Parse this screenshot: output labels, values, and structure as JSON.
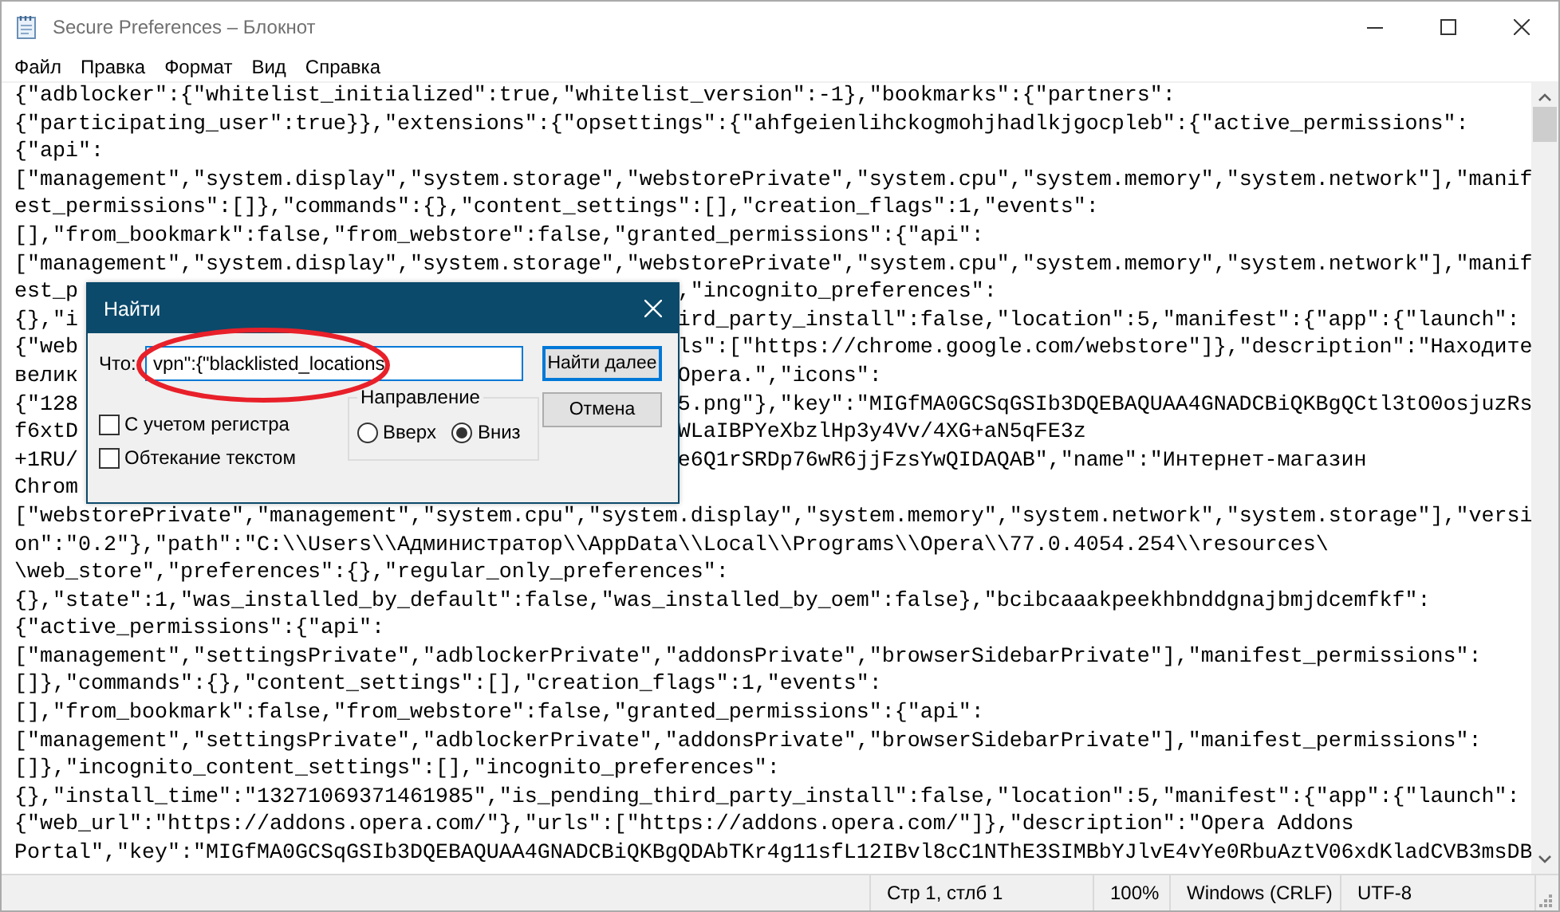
{
  "window": {
    "title": "Secure Preferences – Блокнот"
  },
  "menu": [
    "Файл",
    "Правка",
    "Формат",
    "Вид",
    "Справка"
  ],
  "editor": {
    "lines": [
      {
        "text": "{\"adblocker\":{\"whitelist_initialized\":true,\"whitelist_version\":-1},\"bookmarks\":{\"partners\":"
      },
      {
        "text": "{\"participating_user\":true}},\"extensions\":{\"opsettings\":{\"ahfgeienlihckogmohjhadlkjgocpleb\":{\"active_permissions\":"
      },
      {
        "text": "{\"api\":"
      },
      {
        "text": "[\"management\",\"system.display\",\"system.storage\",\"webstorePrivate\",\"system.cpu\",\"system.memory\",\"system.network\"],\"manif"
      },
      {
        "text": "est_permissions\":[]},\"commands\":{},\"content_settings\":[],\"creation_flags\":1,\"events\":"
      },
      {
        "text": "[],\"from_bookmark\":false,\"from_webstore\":false,\"granted_permissions\":{\"api\":"
      },
      {
        "text": "[\"management\",\"system.display\",\"system.storage\",\"webstorePrivate\",\"system.cpu\",\"system.memory\",\"system.network\"],\"manif"
      },
      {
        "left": "est_p",
        "right": ",\"incognito_preferences\":"
      },
      {
        "left": "{},\"i",
        "right": "ird_party_install\":false,\"location\":5,\"manifest\":{\"app\":{\"launch\":"
      },
      {
        "left": "{\"web",
        "right": "ls\":[\"https://chrome.google.com/webstore\"]},\"description\":\"Находите"
      },
      {
        "left": "велик",
        "right": "Opera.\",\"icons\":"
      },
      {
        "left": "{\"128",
        "right": "5.png\"},\"key\":\"MIGfMA0GCSqGSIb3DQEBAQUAA4GNADCBiQKBgQCtl3tO0osjuzRs"
      },
      {
        "left": "f6xtD",
        "right": "WLaIBPYeXbzlHp3y4Vv/4XG+aN5qFE3z"
      },
      {
        "left": "+1RU/",
        "right": "e6Q1rSRDp76wR6jjFzsYwQIDAQAB\",\"name\":\"Интернет-магазин"
      },
      {
        "left": "Chrom"
      },
      {
        "text": "[\"webstorePrivate\",\"management\",\"system.cpu\",\"system.display\",\"system.memory\",\"system.network\",\"system.storage\"],\"versi"
      },
      {
        "text": "on\":\"0.2\"},\"path\":\"C:\\\\Users\\\\Администратор\\\\AppData\\\\Local\\\\Programs\\\\Opera\\\\77.0.4054.254\\\\resources\\"
      },
      {
        "text": "\\web_store\",\"preferences\":{},\"regular_only_preferences\":"
      },
      {
        "text": "{},\"state\":1,\"was_installed_by_default\":false,\"was_installed_by_oem\":false},\"bcibcaaakpeekhbnddgnajbmjdcemfkf\":"
      },
      {
        "text": "{\"active_permissions\":{\"api\":"
      },
      {
        "text": "[\"management\",\"settingsPrivate\",\"adblockerPrivate\",\"addonsPrivate\",\"browserSidebarPrivate\"],\"manifest_permissions\":"
      },
      {
        "text": "[]},\"commands\":{},\"content_settings\":[],\"creation_flags\":1,\"events\":"
      },
      {
        "text": "[],\"from_bookmark\":false,\"from_webstore\":false,\"granted_permissions\":{\"api\":"
      },
      {
        "text": "[\"management\",\"settingsPrivate\",\"adblockerPrivate\",\"addonsPrivate\",\"browserSidebarPrivate\"],\"manifest_permissions\":"
      },
      {
        "text": "[]},\"incognito_content_settings\":[],\"incognito_preferences\":"
      },
      {
        "text": "{},\"install_time\":\"13271069371461985\",\"is_pending_third_party_install\":false,\"location\":5,\"manifest\":{\"app\":{\"launch\":"
      },
      {
        "text": "{\"web_url\":\"https://addons.opera.com/\"},\"urls\":[\"https://addons.opera.com/\"]},\"description\":\"Opera Addons"
      },
      {
        "text": "Portal\",\"key\":\"MIGfMA0GCSqGSIb3DQEBAQUAA4GNADCBiQKBgQDAbTKr4g11sfL12IBvl8cC1NThE3SIMBbYJlvE4vYe0RbuAztV06xdKladCVB3msDB"
      }
    ]
  },
  "find_dialog": {
    "title": "Найти",
    "find_label": "Что:",
    "query": "vpn\":{\"blacklisted_locations",
    "buttons": [
      {
        "label": "Найти далее",
        "default": true
      },
      {
        "label": "Отмена",
        "default": false
      }
    ],
    "direction": {
      "label": "Направление",
      "options": [
        {
          "label": "Вверх",
          "selected": false
        },
        {
          "label": "Вниз",
          "selected": true
        }
      ]
    },
    "options": [
      {
        "label": "С учетом регистра",
        "checked": false
      },
      {
        "label": "Обтекание текстом",
        "checked": false
      }
    ]
  },
  "status_bar": [
    "Стр 1, стлб 1",
    "100%",
    "Windows (CRLF)",
    "UTF-8"
  ]
}
